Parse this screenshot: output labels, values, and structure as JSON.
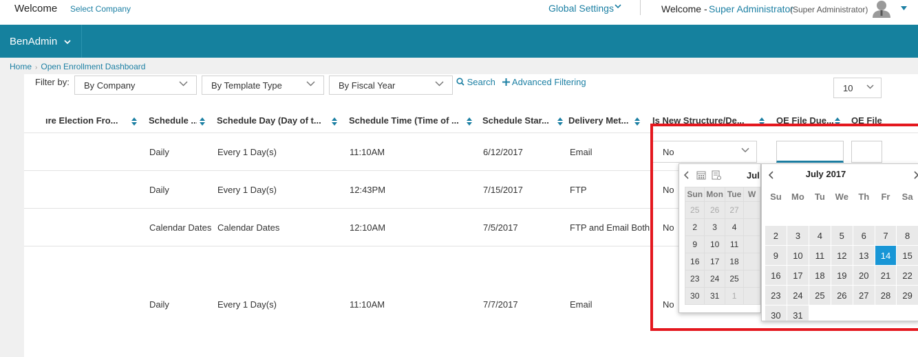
{
  "top": {
    "welcome": "Welcome",
    "select_company": "Select Company",
    "global_settings": "Global Settings",
    "welcome_prefix": "Welcome -",
    "user_name": "Super Administrator",
    "user_role": "(Super Administrator)"
  },
  "nav": {
    "app_name": "BenAdmin"
  },
  "breadcrumb": {
    "home": "Home",
    "current": "Open Enrollment Dashboard"
  },
  "filters": {
    "label": "Filter by:",
    "company": "By Company",
    "template_type": "By Template Type",
    "fiscal_year": "By Fiscal Year",
    "search": "Search",
    "advanced": "Advanced Filtering",
    "page_size": "10"
  },
  "grid": {
    "columns": [
      "ıre Election Fro...",
      "Schedule ...",
      "Schedule Day (Day of t...",
      "Schedule Time (Time of ...",
      "Schedule Star...",
      "Delivery Met...",
      "Is New Structure/De...",
      "OE File Due...",
      "OE File"
    ],
    "rows": [
      {
        "schedule": "Daily",
        "day": "Every 1 Day(s)",
        "time": "11:10AM",
        "start": "6/12/2017",
        "delivery": "Email",
        "is_new": "No"
      },
      {
        "schedule": "Daily",
        "day": "Every 1 Day(s)",
        "time": "12:43PM",
        "start": "7/15/2017",
        "delivery": "FTP",
        "is_new": "No"
      },
      {
        "schedule": "Calendar Dates",
        "day": "Calendar Dates",
        "time": "12:10AM",
        "start": "7/5/2017",
        "delivery": "FTP and Email Both",
        "is_new": "No"
      },
      {
        "schedule": "Daily",
        "day": "Every 1 Day(s)",
        "time": "11:10AM",
        "start": "7/7/2017",
        "delivery": "Email",
        "is_new": "No"
      }
    ]
  },
  "calendar_small": {
    "month": "Jul",
    "weekdays": [
      "Sun",
      "Mon",
      "Tue",
      "W"
    ],
    "rows": [
      [
        "25",
        "26",
        "27",
        ""
      ],
      [
        "2",
        "3",
        "4",
        ""
      ],
      [
        "9",
        "10",
        "11",
        ""
      ],
      [
        "16",
        "17",
        "18",
        ""
      ],
      [
        "23",
        "24",
        "25",
        ""
      ],
      [
        "30",
        "31",
        "1",
        ""
      ]
    ]
  },
  "calendar_large": {
    "month": "July 2017",
    "weekdays": [
      "Su",
      "Mo",
      "Tu",
      "We",
      "Th",
      "Fr",
      "Sa"
    ],
    "rows": [
      [
        "",
        "",
        "",
        "",
        "",
        "",
        ""
      ],
      [
        "2",
        "3",
        "4",
        "5",
        "6",
        "7",
        "8"
      ],
      [
        "9",
        "10",
        "11",
        "12",
        "13",
        "14",
        "15"
      ],
      [
        "16",
        "17",
        "18",
        "19",
        "20",
        "21",
        "22"
      ],
      [
        "23",
        "24",
        "25",
        "26",
        "27",
        "28",
        "29"
      ],
      [
        "30",
        "31",
        "",
        "",
        "",
        "",
        ""
      ]
    ],
    "selected": "14"
  },
  "colors": {
    "brand": "#15819e",
    "link": "#1b7fa3",
    "selected_day": "#1896d6",
    "annotation": "#e4171e"
  }
}
